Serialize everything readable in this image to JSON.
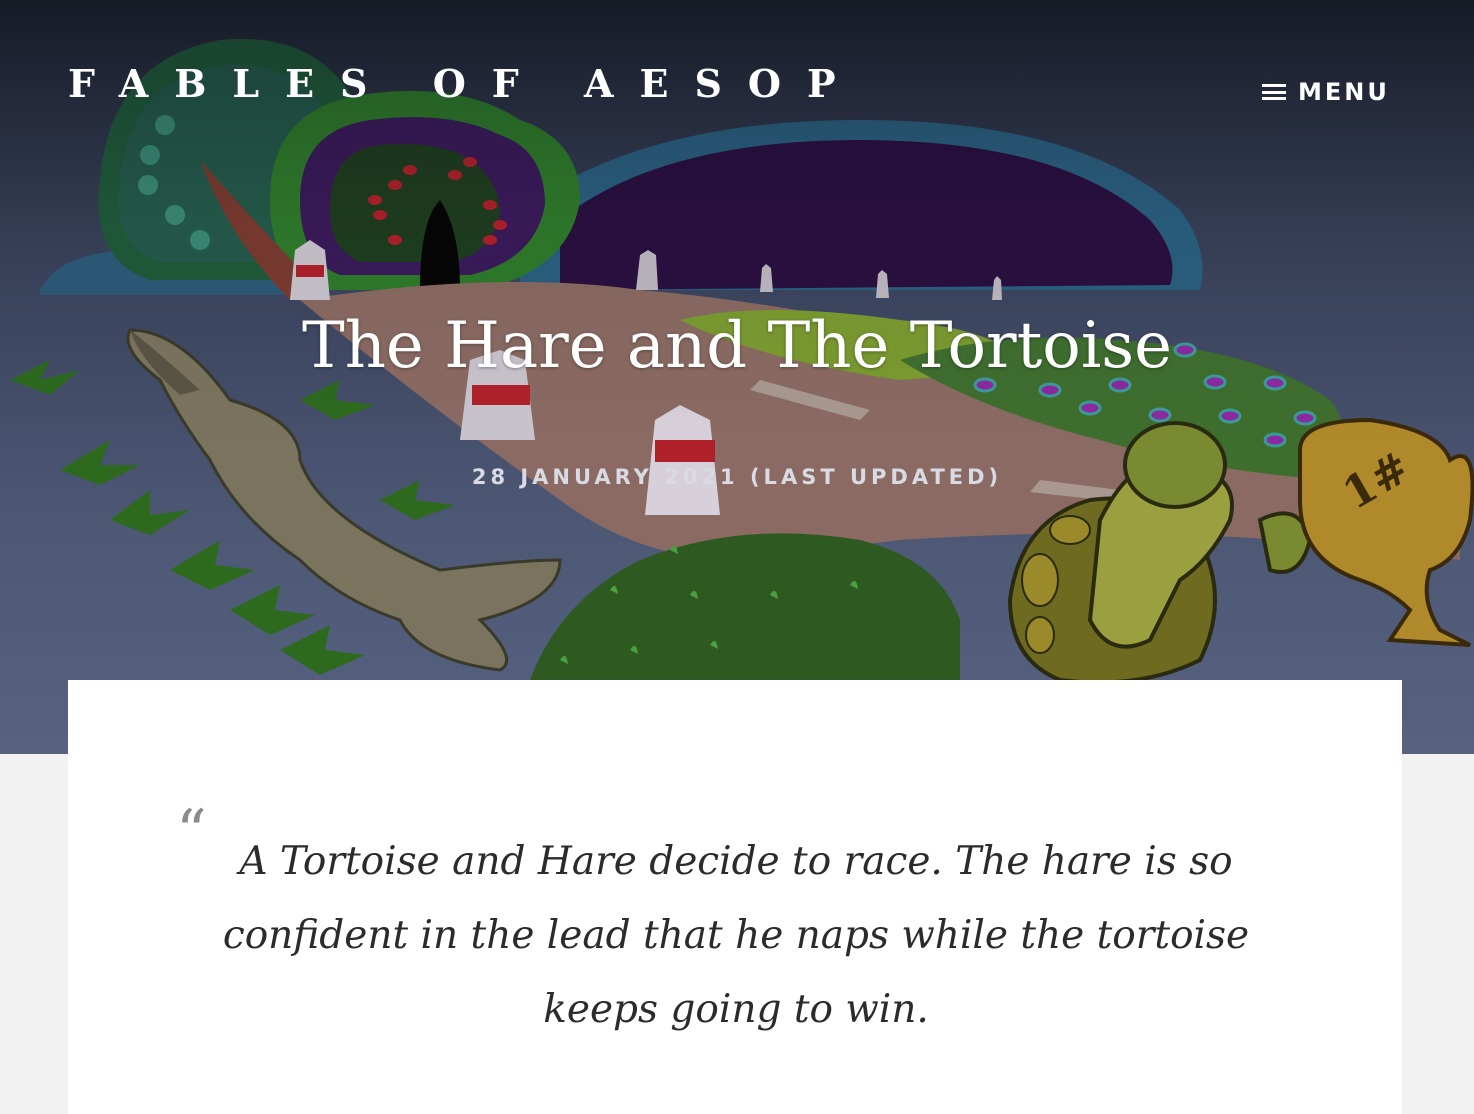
{
  "header": {
    "site_title": "FABLES OF AESOP",
    "menu_label": "MENU"
  },
  "post": {
    "title": "The Hare and The Tortoise",
    "date_line": "28 JANUARY 2021 (LAST UPDATED)",
    "excerpt": "A Tortoise and Hare decide to race. The hare is so confident in the lead that he naps while the tortoise keeps going to win."
  },
  "trophy_label": "1#",
  "icons": {
    "menu": "hamburger-menu-icon",
    "quote": "open-quote-icon"
  },
  "colors": {
    "hero_overlay": "#3d4660",
    "page_background": "#f2f2f2",
    "card_background": "#ffffff",
    "quote_text": "#2b2b2b",
    "quote_mark": "#8a8a8a"
  }
}
